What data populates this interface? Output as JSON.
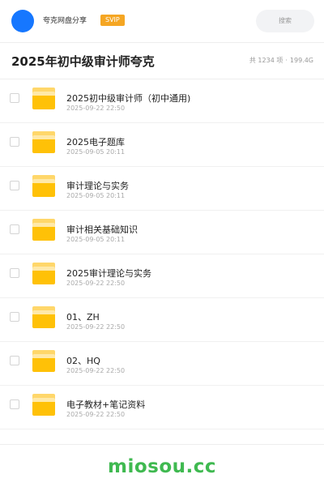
{
  "header": {
    "app_name": "夸克网盘分享",
    "badge": "SVIP",
    "search_placeholder": "搜索",
    "avatar_color": "#1677ff",
    "badge_color": "#f5a623"
  },
  "page": {
    "title": "2025年初中级审计师夸克",
    "count": "共 1234 项",
    "separator": "·",
    "size": "199.4G"
  },
  "files": [
    {
      "name": "2025初中级审计师（初中通用)",
      "date": "2025-09-22 22:50",
      "icon": "folder-icon"
    },
    {
      "name": "2025电子题库",
      "date": "2025-09-05 20:11",
      "icon": "folder-icon"
    },
    {
      "name": "审计理论与实务",
      "date": "2025-09-05 20:11",
      "icon": "folder-icon"
    },
    {
      "name": "审计相关基础知识",
      "date": "2025-09-05 20:11",
      "icon": "folder-icon"
    },
    {
      "name": "2025审计理论与实务",
      "date": "2025-09-22 22:50",
      "icon": "folder-icon"
    },
    {
      "name": "01、ZH",
      "date": "2025-09-22 22:50",
      "icon": "folder-icon"
    },
    {
      "name": "02、HQ",
      "date": "2025-09-22 22:50",
      "icon": "folder-icon"
    },
    {
      "name": "电子教材+笔记资料",
      "date": "2025-09-22 22:50",
      "icon": "folder-icon"
    }
  ],
  "footer": {
    "watermark": "miosou.cc",
    "watermark_color": "#3fb950"
  }
}
